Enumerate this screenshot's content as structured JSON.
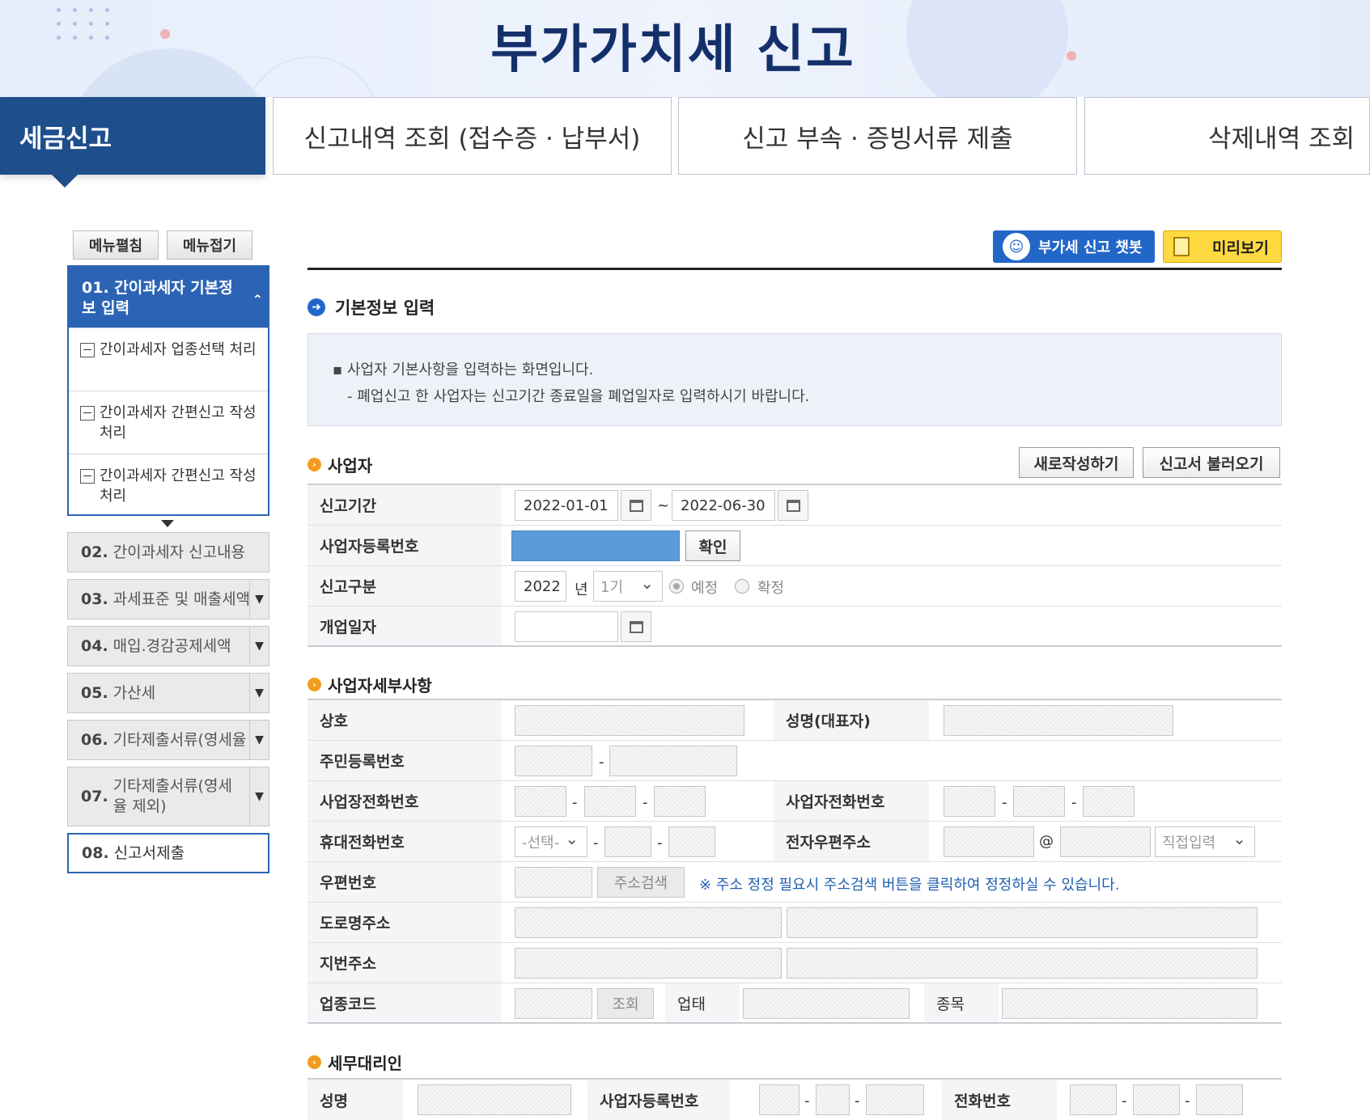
{
  "header": {
    "title": "부가가치세 신고"
  },
  "tabs": [
    {
      "label": "세금신고",
      "active": true
    },
    {
      "label": "신고내역 조회 (접수증 · 납부서)"
    },
    {
      "label": "신고 부속 · 증빙서류 제출"
    },
    {
      "label": "삭제내역 조회"
    }
  ],
  "sidebar": {
    "expand_label": "메뉴펼침",
    "collapse_label": "메뉴접기",
    "step1": {
      "num": "01.",
      "title": "간이과세자 기본정보 입력"
    },
    "subitems": [
      "간이과세자 업종선택 처리",
      "간이과세자 간편신고 작성 처리",
      "간이과세자 간편신고 작성 처리"
    ],
    "steps": [
      {
        "num": "02.",
        "title": "간이과세자 신고내용"
      },
      {
        "num": "03.",
        "title": "과세표준 및 매출세액"
      },
      {
        "num": "04.",
        "title": "매입.경감공제세액"
      },
      {
        "num": "05.",
        "title": "가산세"
      },
      {
        "num": "06.",
        "title": "기타제출서류(영세율"
      },
      {
        "num": "07.",
        "title": "기타제출서류(영세율 제외)"
      },
      {
        "num": "08.",
        "title": "신고서제출"
      }
    ]
  },
  "toolbar": {
    "chatbot_label": "부가세 신고 챗봇",
    "preview_label": "미리보기"
  },
  "main": {
    "section_title": "기본정보 입력",
    "info_lines": [
      "▪ 사업자 기본사항을 입력하는 화면입니다.",
      "  - 폐업신고 한 사업자는 신고기간 종료일을 폐업일자로 입력하시기 바랍니다."
    ],
    "business": {
      "title": "사업자",
      "new_button": "새로작성하기",
      "load_button": "신고서 불러오기",
      "period_label": "신고기간",
      "period_start": "2022-01-01",
      "period_sep": "~",
      "period_end": "2022-06-30",
      "regno_label": "사업자등록번호",
      "confirm_button": "확인",
      "type_label": "신고구분",
      "year": "2022",
      "year_unit": "년",
      "term": "1기",
      "radio_prelim": "예정",
      "radio_final": "확정",
      "open_label": "개업일자"
    },
    "detail": {
      "title": "사업자세부사항",
      "trade_name": "상호",
      "rep_name": "성명(대표자)",
      "resident_no": "주민등록번호",
      "biz_phone": "사업장전화번호",
      "owner_phone": "사업자전화번호",
      "mobile": "휴대전화번호",
      "mobile_select": "-선택-",
      "email": "전자우편주소",
      "email_at": "@",
      "email_domain": "직접입력",
      "zip": "우편번호",
      "addr_search": "주소검색",
      "addr_note": "※ 주소 정정 필요시 주소검색 버튼을 클릭하여 정정하실 수 있습니다.",
      "road_addr": "도로명주소",
      "lot_addr": "지번주소",
      "industry_code": "업종코드",
      "lookup": "조회",
      "biz_type": "업태",
      "biz_item": "종목"
    },
    "agent": {
      "title": "세무대리인",
      "name": "성명",
      "regno": "사업자등록번호",
      "phone": "전화번호"
    },
    "dash": "-"
  }
}
